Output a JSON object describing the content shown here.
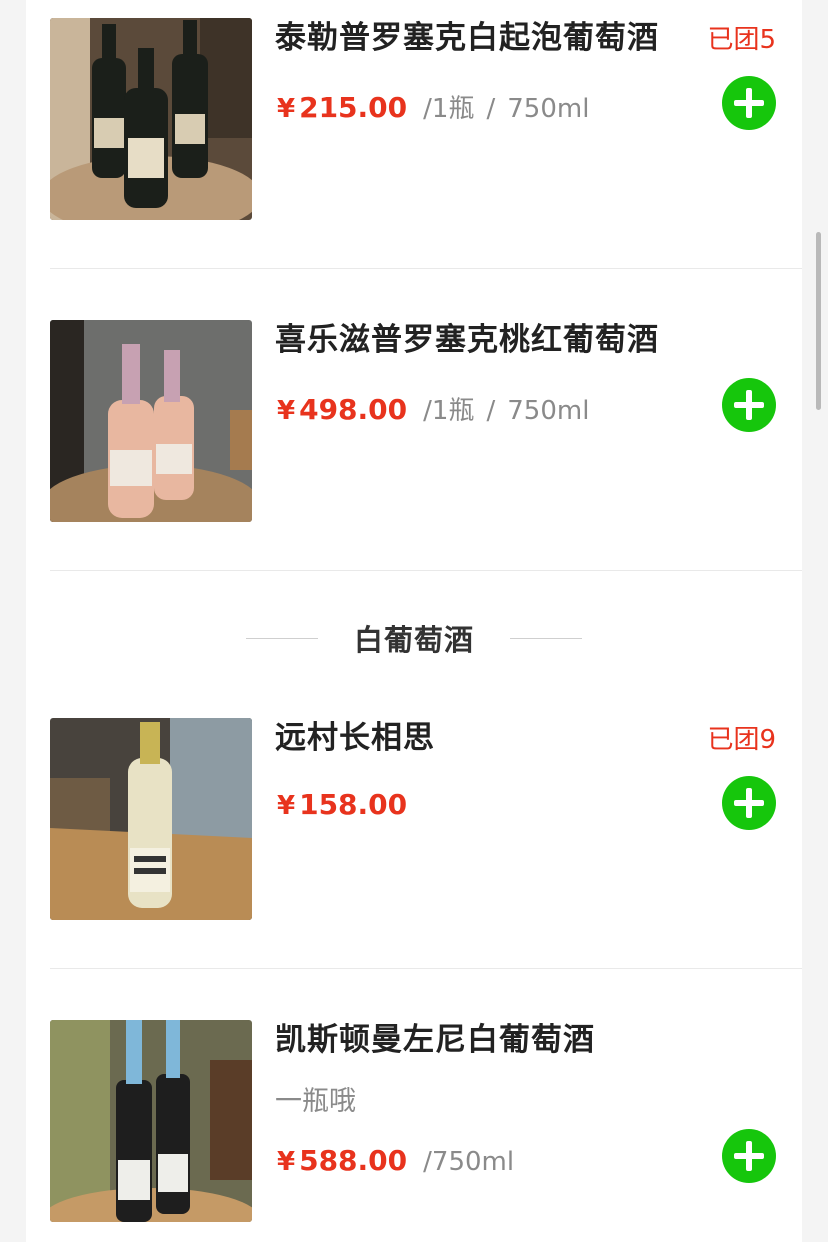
{
  "products": [
    {
      "name": "泰勒普罗塞克白起泡葡萄酒",
      "sold_label": "已团5",
      "currency": "¥",
      "price": "215.00",
      "unit": "/1瓶",
      "separator": "/",
      "volume": "750ml",
      "image": "prosecco-three-bottles-photo"
    },
    {
      "name": "喜乐滋普罗塞克桃红葡萄酒",
      "currency": "¥",
      "price": "498.00",
      "unit": "/1瓶",
      "separator": "/",
      "volume": "750ml",
      "image": "rose-prosecco-two-bottles-photo"
    },
    {
      "name": "远村长相思",
      "sold_label": "已团9",
      "currency": "¥",
      "price": "158.00",
      "image": "long-country-white-wine-photo"
    },
    {
      "name": "凯斯顿曼左尼白葡萄酒",
      "subtitle": "一瓶哦",
      "currency": "¥",
      "price": "588.00",
      "unit": "/750ml",
      "image": "riesling-two-bottles-photo"
    }
  ],
  "section_header": "白葡萄酒",
  "add_icon": "plus-circle-icon",
  "colors": {
    "price": "#e8331d",
    "add_button": "#16c60c",
    "background": "#f4f4f4"
  }
}
